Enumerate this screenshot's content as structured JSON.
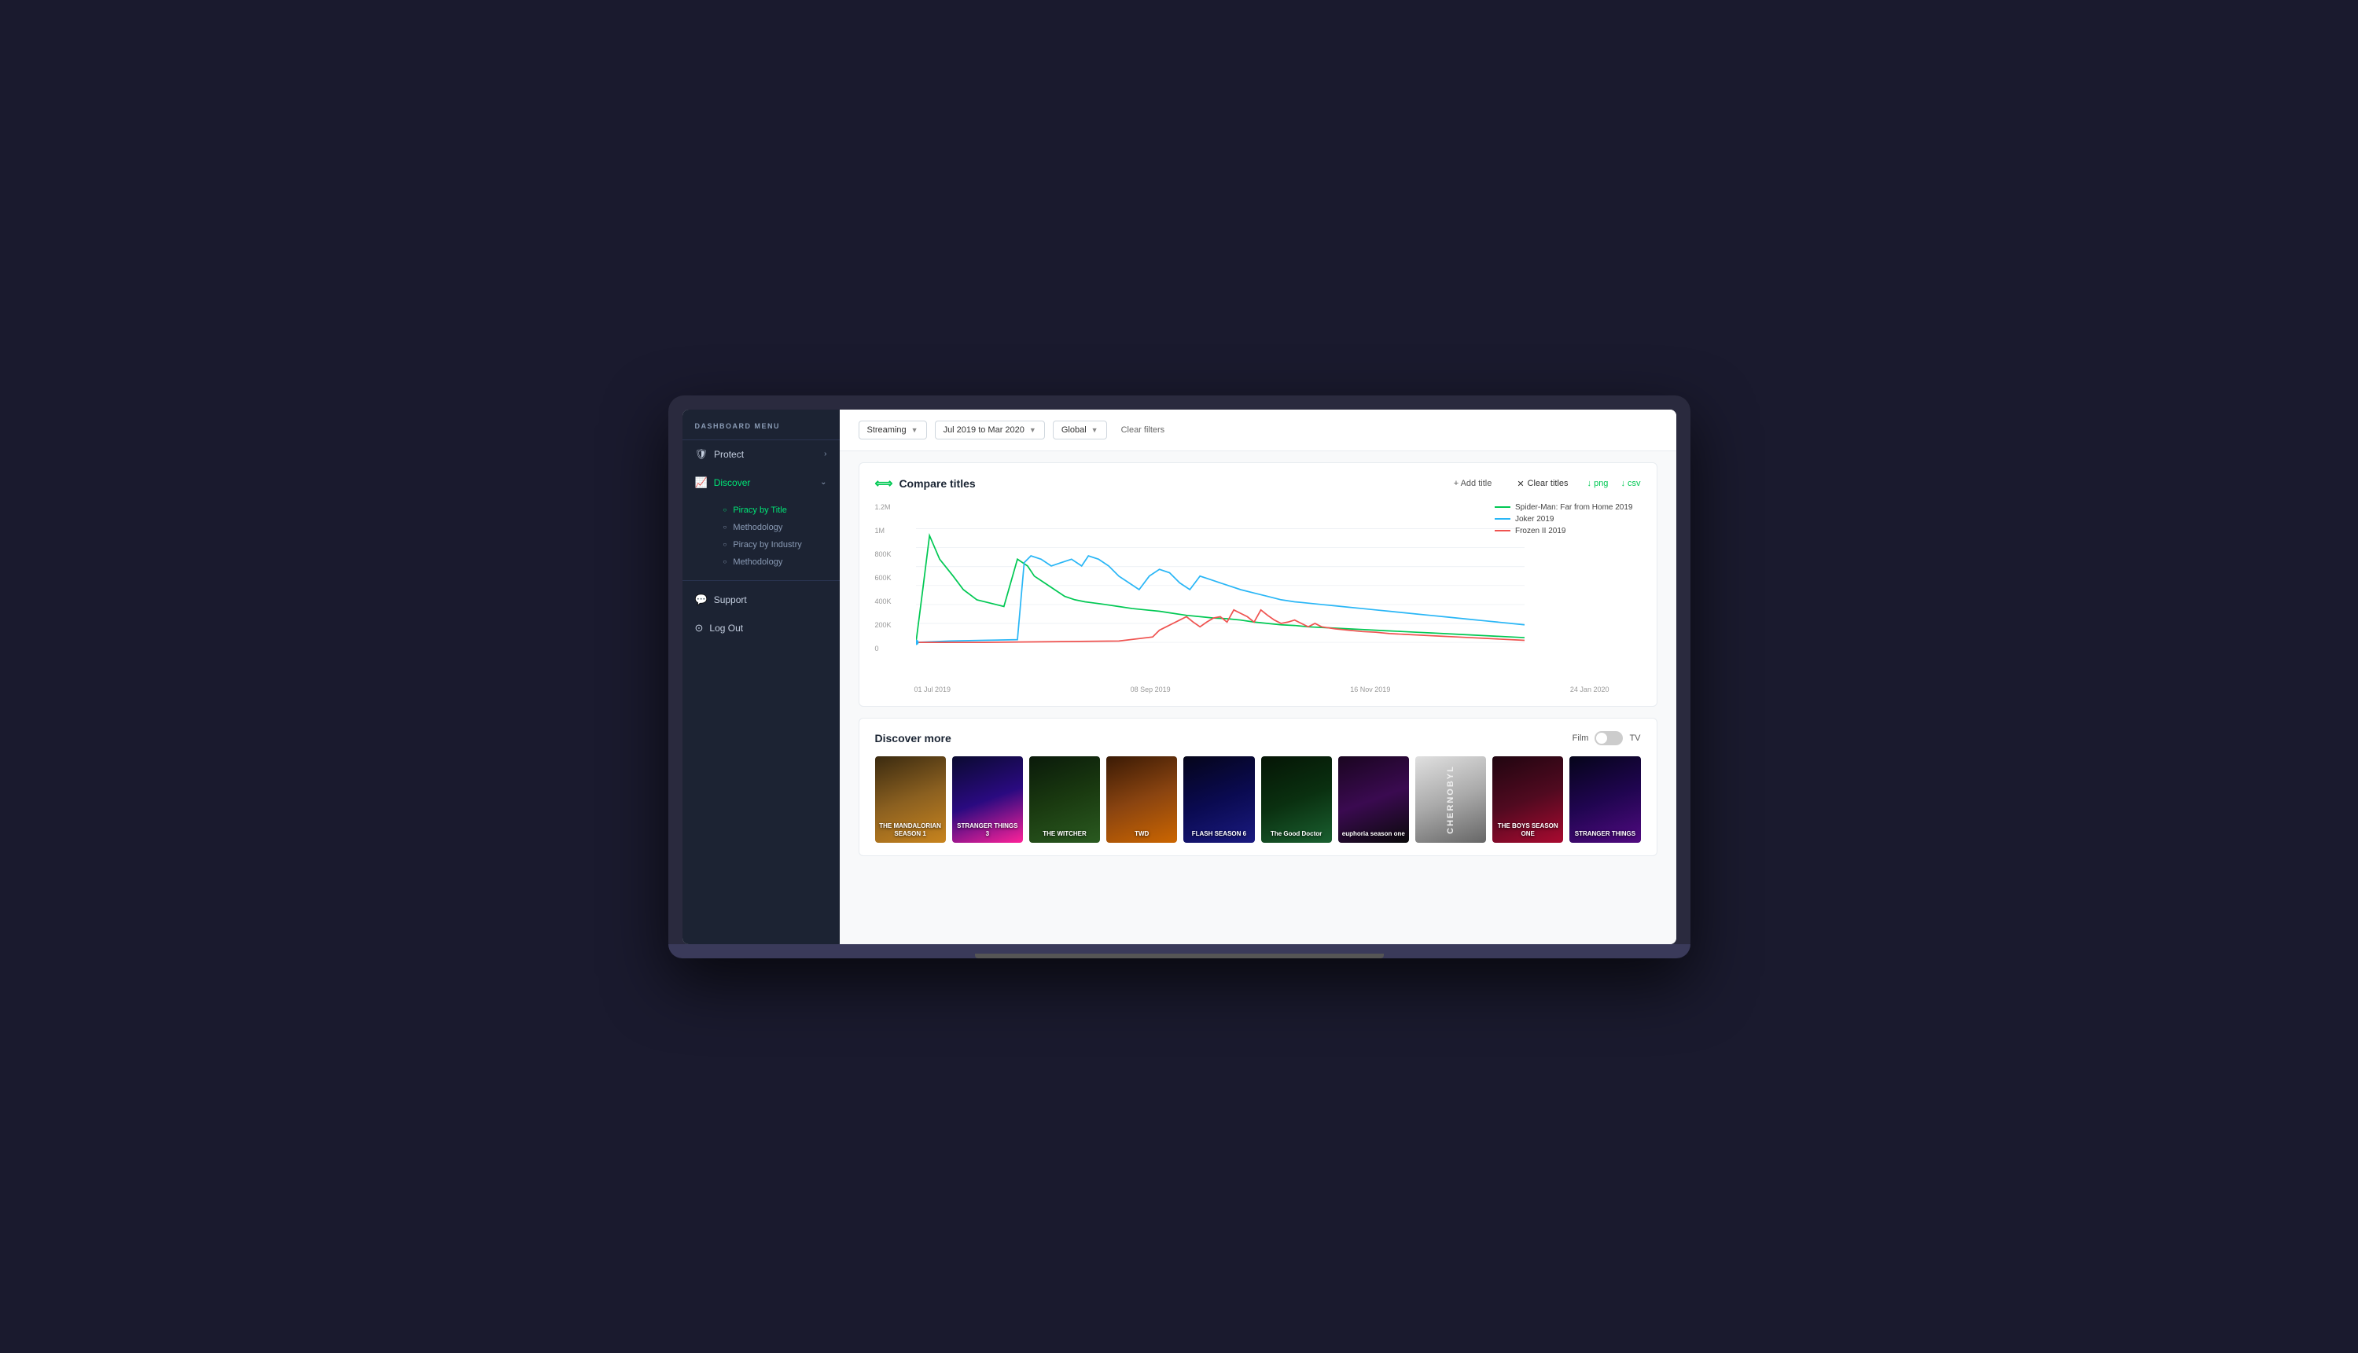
{
  "sidebar": {
    "menu_label": "DASHBOARD MENU",
    "items": [
      {
        "id": "protect",
        "label": "Protect",
        "icon": "🛡",
        "arrow": "›",
        "active": false
      },
      {
        "id": "discover",
        "label": "Discover",
        "icon": "📊",
        "arrow": "⌄",
        "active": true
      }
    ],
    "sub_items_discover": [
      {
        "id": "piracy-by-title",
        "label": "Piracy by Title",
        "active": true
      },
      {
        "id": "methodology-1",
        "label": "Methodology",
        "active": false
      }
    ],
    "industry_items": [
      {
        "id": "piracy-by-industry",
        "label": "Piracy by Industry",
        "active": false
      },
      {
        "id": "methodology-2",
        "label": "Methodology",
        "active": false
      }
    ],
    "bottom_items": [
      {
        "id": "support",
        "label": "Support",
        "icon": "💬"
      },
      {
        "id": "logout",
        "label": "Log Out",
        "icon": "⊙"
      }
    ]
  },
  "filters": {
    "streaming_label": "Streaming",
    "date_range_label": "Jul 2019 to Mar 2020",
    "region_label": "Global",
    "clear_filters_label": "Clear filters"
  },
  "compare_section": {
    "title": "Compare titles",
    "add_title_label": "+ Add title",
    "clear_titles_label": "Clear titles",
    "png_label": "↓ png",
    "csv_label": "↓ csv",
    "legend": [
      {
        "label": "Spider-Man: Far from Home 2019",
        "color": "#00c853"
      },
      {
        "label": "Joker 2019",
        "color": "#29b6f6"
      },
      {
        "label": "Frozen II 2019",
        "color": "#ef5350"
      }
    ],
    "y_labels": [
      "1.2M",
      "1M",
      "800K",
      "600K",
      "400K",
      "200K",
      "0"
    ],
    "x_labels": [
      "01 Jul 2019",
      "08 Sep 2019",
      "16 Nov 2019",
      "24 Jan 2020"
    ]
  },
  "discover_section": {
    "title": "Discover more",
    "film_label": "Film",
    "tv_label": "TV",
    "posters": [
      {
        "id": "mandalorian",
        "label": "THE MANDALORIAN\nSEASON 1",
        "class": "poster-1"
      },
      {
        "id": "stranger-things-3",
        "label": "STRANGER THINGS 3",
        "class": "poster-2"
      },
      {
        "id": "the-witcher",
        "label": "THE WITCHER",
        "class": "poster-3"
      },
      {
        "id": "walking-dead",
        "label": "TWD",
        "class": "poster-4"
      },
      {
        "id": "the-flash",
        "label": "FLASH\nSEASON 6",
        "class": "poster-5"
      },
      {
        "id": "good-doctor",
        "label": "The Good Doctor",
        "class": "poster-6"
      },
      {
        "id": "euphoria",
        "label": "euphoria\nseason one",
        "class": "poster-7"
      },
      {
        "id": "chernobyl",
        "label": "CHERNOBYL",
        "class": "poster-8"
      },
      {
        "id": "the-boys",
        "label": "THE BOYS\nSEASON ONE",
        "class": "poster-9"
      },
      {
        "id": "stranger-things",
        "label": "STRANGER THINGS",
        "class": "poster-10"
      }
    ]
  }
}
